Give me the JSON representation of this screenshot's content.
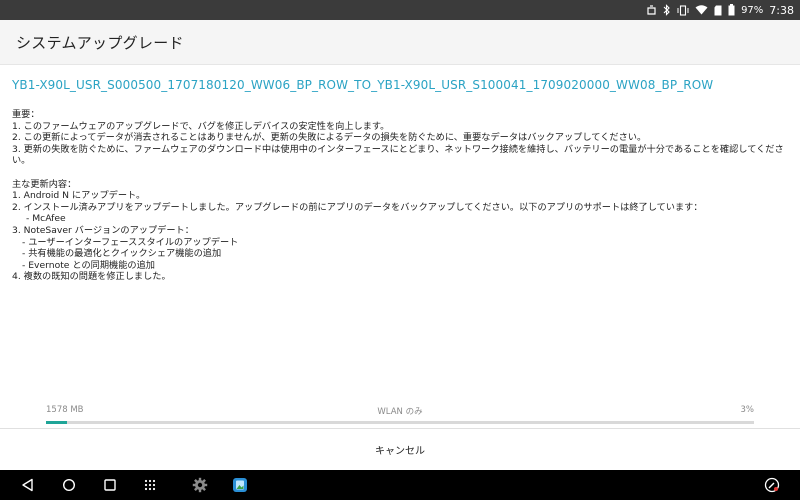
{
  "status_bar": {
    "battery": "97%",
    "time": "7:38",
    "icons": [
      "notification-icon",
      "bluetooth-icon",
      "vibrate-icon",
      "wifi-icon",
      "sd-card-icon",
      "battery-icon"
    ]
  },
  "app_bar": {
    "title": "システムアップグレード"
  },
  "update": {
    "firmware_name": "YB1-X90L_USR_S000500_1707180120_WW06_BP_ROW_TO_YB1-X90L_USR_S100041_1709020000_WW08_BP_ROW",
    "important_heading": "重要：",
    "important": [
      "1. このファームウェアのアップグレードで、バグを修正しデバイスの安定性を向上します。",
      "2. この更新によってデータが消去されることはありませんが、更新の失敗によるデータの損失を防ぐために、重要なデータはバックアップしてください。",
      "3. 更新の失敗を防ぐために、ファームウェアのダウンロード中は使用中のインターフェースにとどまり、ネットワーク接続を維持し、バッテリーの電量が十分であることを確認してください。"
    ],
    "changes_heading": "主な更新内容：",
    "changes": {
      "c1": "1. Android N にアップデート。",
      "c2": "2. インストール済みアプリをアップデートしました。アップグレードの前にアプリのデータをバックアップしてください。以下のアプリのサポートは終了しています：",
      "c2_sub": "- McAfee",
      "c3": "3. NoteSaver バージョンのアップデート：",
      "c3_sub1": "- ユーザーインターフェーススタイルのアップデート",
      "c3_sub2": "- 共有機能の最適化とクイックシェア機能の追加",
      "c3_sub3": "- Evernote との同期機能の追加",
      "c4": "4. 複数の既知の問題を修正しました。"
    }
  },
  "download": {
    "size": "1578 MB",
    "network": "WLAN のみ",
    "percent_label": "3%",
    "progress": 0.03,
    "progress_color": "#1fa598"
  },
  "actions": {
    "cancel_label": "キャンセル"
  },
  "nav_bar": {
    "buttons": [
      "back-icon",
      "home-icon",
      "recents-icon",
      "app-drawer-icon",
      "settings-app-icon",
      "gallery-app-icon",
      "stylus-icon"
    ]
  },
  "colors": {
    "accent": "#2ba3c4",
    "status_bar": "#3b3b3b",
    "nav_bar": "#000000"
  }
}
